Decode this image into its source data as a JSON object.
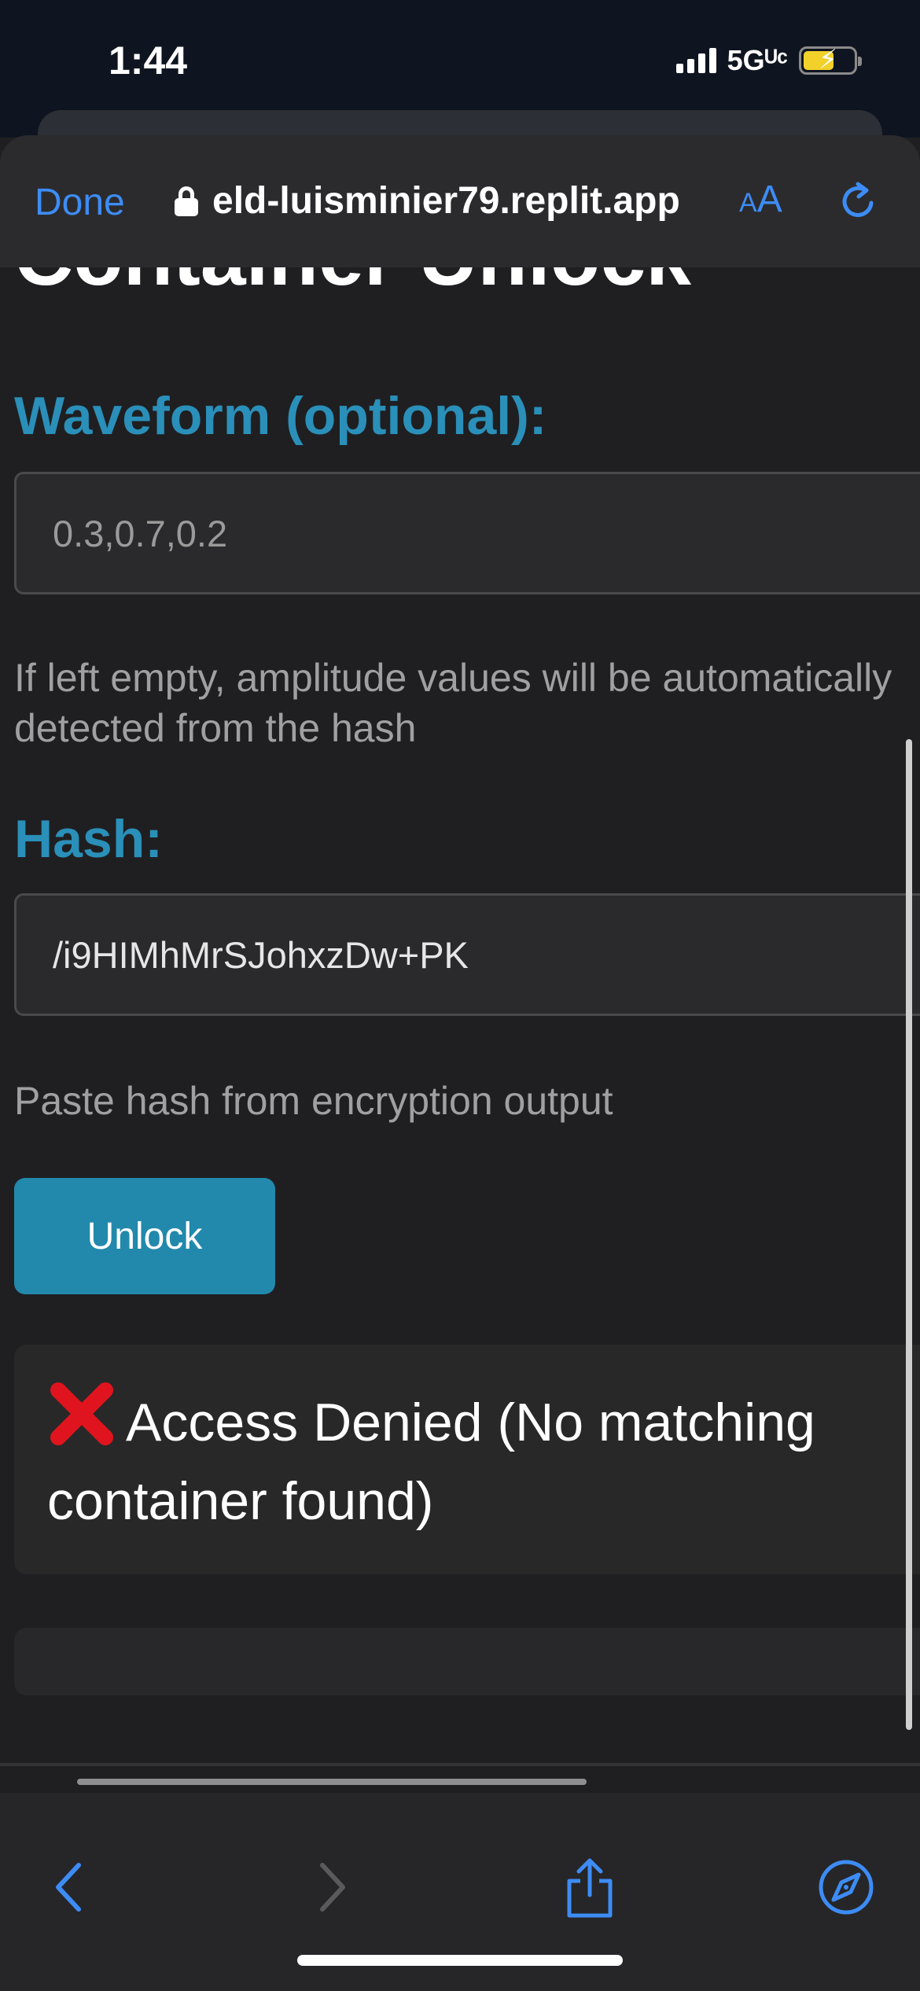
{
  "status_bar": {
    "time": "1:44",
    "network": "5Gᵁᶜ"
  },
  "browser": {
    "done_label": "Done",
    "url": "eld-luisminier79.replit.app",
    "text_size_small": "A",
    "text_size_large": "A",
    "accent_color": "#3d8cf5"
  },
  "page": {
    "heading": "Container Unlock",
    "waveform": {
      "label": "Waveform (optional):",
      "placeholder": "0.3,0.7,0.2",
      "help": "If left empty, amplitude values will be automatically detected from the hash"
    },
    "hash": {
      "label": "Hash:",
      "value": "/i9HIMhMrSJohxzDw+PK",
      "help": "Paste hash from encryption output"
    },
    "unlock_label": "Unlock",
    "result": {
      "text": "Access Denied (No matching container found)",
      "icon": "cross-mark-icon",
      "icon_color": "#e0141e"
    }
  },
  "colors": {
    "label_color": "#2a8fb9",
    "button_color": "#2289ad"
  }
}
